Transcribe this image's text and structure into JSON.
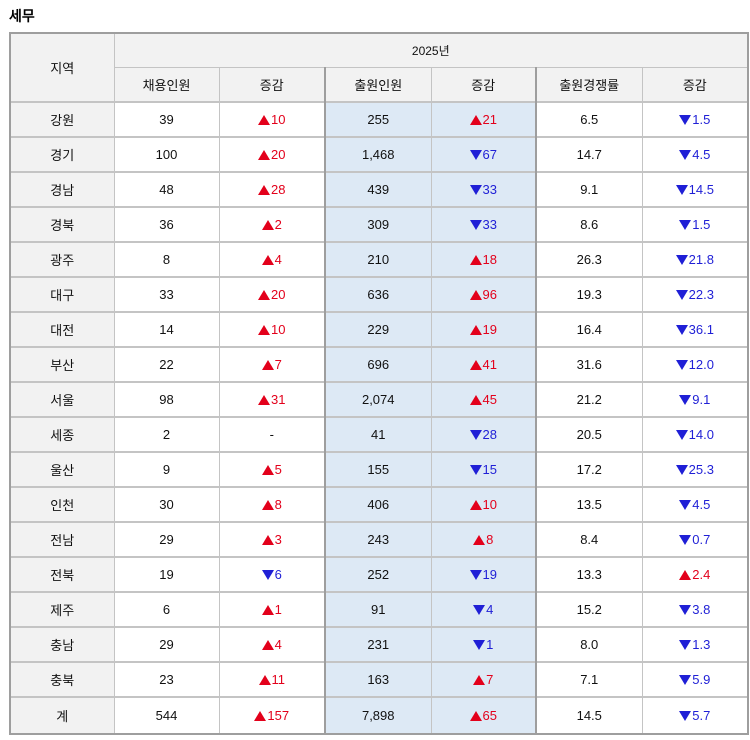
{
  "title": "세무",
  "header": {
    "region": "지역",
    "year": "2025년",
    "cols": [
      "채용인원",
      "증감",
      "출원인원",
      "증감",
      "출원경쟁률",
      "증감"
    ]
  },
  "colors": {
    "up": "#e3001b",
    "down": "#1f1fd6",
    "highlight": "#dde9f5"
  },
  "rows": [
    {
      "region": "강원",
      "hire": "39",
      "hire_dir": "up",
      "hire_chg": "10",
      "apps": "255",
      "apps_dir": "up",
      "apps_chg": "21",
      "ratio": "6.5",
      "ratio_dir": "down",
      "ratio_chg": "1.5"
    },
    {
      "region": "경기",
      "hire": "100",
      "hire_dir": "up",
      "hire_chg": "20",
      "apps": "1,468",
      "apps_dir": "down",
      "apps_chg": "67",
      "ratio": "14.7",
      "ratio_dir": "down",
      "ratio_chg": "4.5"
    },
    {
      "region": "경남",
      "hire": "48",
      "hire_dir": "up",
      "hire_chg": "28",
      "apps": "439",
      "apps_dir": "down",
      "apps_chg": "33",
      "ratio": "9.1",
      "ratio_dir": "down",
      "ratio_chg": "14.5"
    },
    {
      "region": "경북",
      "hire": "36",
      "hire_dir": "up",
      "hire_chg": "2",
      "apps": "309",
      "apps_dir": "down",
      "apps_chg": "33",
      "ratio": "8.6",
      "ratio_dir": "down",
      "ratio_chg": "1.5"
    },
    {
      "region": "광주",
      "hire": "8",
      "hire_dir": "up",
      "hire_chg": "4",
      "apps": "210",
      "apps_dir": "up",
      "apps_chg": "18",
      "ratio": "26.3",
      "ratio_dir": "down",
      "ratio_chg": "21.8"
    },
    {
      "region": "대구",
      "hire": "33",
      "hire_dir": "up",
      "hire_chg": "20",
      "apps": "636",
      "apps_dir": "up",
      "apps_chg": "96",
      "ratio": "19.3",
      "ratio_dir": "down",
      "ratio_chg": "22.3"
    },
    {
      "region": "대전",
      "hire": "14",
      "hire_dir": "up",
      "hire_chg": "10",
      "apps": "229",
      "apps_dir": "up",
      "apps_chg": "19",
      "ratio": "16.4",
      "ratio_dir": "down",
      "ratio_chg": "36.1"
    },
    {
      "region": "부산",
      "hire": "22",
      "hire_dir": "up",
      "hire_chg": "7",
      "apps": "696",
      "apps_dir": "up",
      "apps_chg": "41",
      "ratio": "31.6",
      "ratio_dir": "down",
      "ratio_chg": "12.0"
    },
    {
      "region": "서울",
      "hire": "98",
      "hire_dir": "up",
      "hire_chg": "31",
      "apps": "2,074",
      "apps_dir": "up",
      "apps_chg": "45",
      "ratio": "21.2",
      "ratio_dir": "down",
      "ratio_chg": "9.1"
    },
    {
      "region": "세종",
      "hire": "2",
      "hire_dir": "none",
      "hire_chg": "-",
      "apps": "41",
      "apps_dir": "down",
      "apps_chg": "28",
      "ratio": "20.5",
      "ratio_dir": "down",
      "ratio_chg": "14.0"
    },
    {
      "region": "울산",
      "hire": "9",
      "hire_dir": "up",
      "hire_chg": "5",
      "apps": "155",
      "apps_dir": "down",
      "apps_chg": "15",
      "ratio": "17.2",
      "ratio_dir": "down",
      "ratio_chg": "25.3"
    },
    {
      "region": "인천",
      "hire": "30",
      "hire_dir": "up",
      "hire_chg": "8",
      "apps": "406",
      "apps_dir": "up",
      "apps_chg": "10",
      "ratio": "13.5",
      "ratio_dir": "down",
      "ratio_chg": "4.5"
    },
    {
      "region": "전남",
      "hire": "29",
      "hire_dir": "up",
      "hire_chg": "3",
      "apps": "243",
      "apps_dir": "up",
      "apps_chg": "8",
      "ratio": "8.4",
      "ratio_dir": "down",
      "ratio_chg": "0.7"
    },
    {
      "region": "전북",
      "hire": "19",
      "hire_dir": "down",
      "hire_chg": "6",
      "apps": "252",
      "apps_dir": "down",
      "apps_chg": "19",
      "ratio": "13.3",
      "ratio_dir": "up",
      "ratio_chg": "2.4"
    },
    {
      "region": "제주",
      "hire": "6",
      "hire_dir": "up",
      "hire_chg": "1",
      "apps": "91",
      "apps_dir": "down",
      "apps_chg": "4",
      "ratio": "15.2",
      "ratio_dir": "down",
      "ratio_chg": "3.8"
    },
    {
      "region": "충남",
      "hire": "29",
      "hire_dir": "up",
      "hire_chg": "4",
      "apps": "231",
      "apps_dir": "down",
      "apps_chg": "1",
      "ratio": "8.0",
      "ratio_dir": "down",
      "ratio_chg": "1.3"
    },
    {
      "region": "충북",
      "hire": "23",
      "hire_dir": "up",
      "hire_chg": "11",
      "apps": "163",
      "apps_dir": "up",
      "apps_chg": "7",
      "ratio": "7.1",
      "ratio_dir": "down",
      "ratio_chg": "5.9"
    }
  ],
  "total": {
    "region": "계",
    "hire": "544",
    "hire_dir": "up",
    "hire_chg": "157",
    "apps": "7,898",
    "apps_dir": "up",
    "apps_chg": "65",
    "ratio": "14.5",
    "ratio_dir": "down",
    "ratio_chg": "5.7"
  }
}
